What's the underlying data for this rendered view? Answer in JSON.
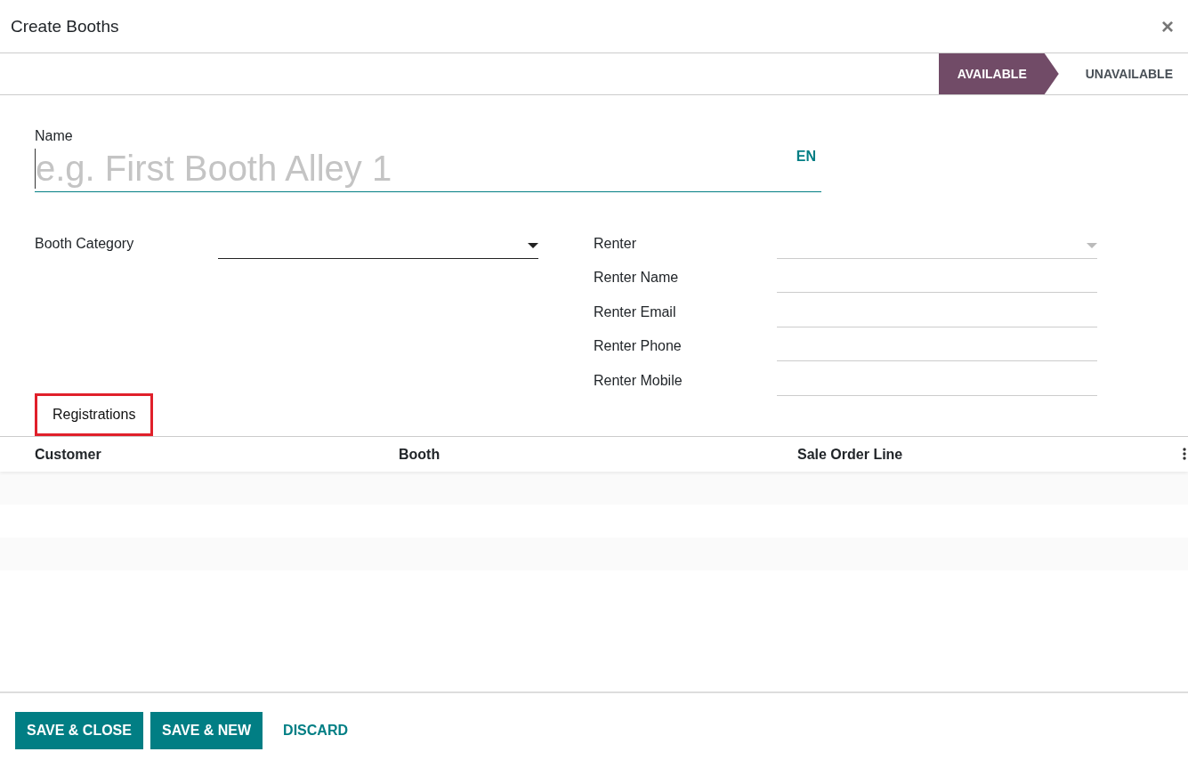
{
  "dialog": {
    "title": "Create Booths",
    "close": "×"
  },
  "status_bar": [
    {
      "label": "AVAILABLE",
      "selected": true
    },
    {
      "label": "UNAVAILABLE",
      "selected": false
    }
  ],
  "name_field": {
    "label": "Name",
    "placeholder": "e.g. First Booth Alley 1",
    "language": "EN"
  },
  "left_fields": [
    {
      "label": "Booth Category",
      "kind": "dropdown",
      "disabled": false
    }
  ],
  "renter_field": {
    "label": "Renter",
    "disabled": true
  },
  "renter_details": [
    {
      "label": "Renter Name"
    },
    {
      "label": "Renter Email"
    },
    {
      "label": "Renter Phone"
    },
    {
      "label": "Renter Mobile"
    }
  ],
  "tabs": [
    {
      "label": "Registrations",
      "selected": true,
      "highlighted": true
    }
  ],
  "table": {
    "columns": [
      "Customer",
      "Booth",
      "Sale Order Line"
    ]
  },
  "buttons": [
    {
      "label": "SAVE & CLOSE",
      "kind": "primary"
    },
    {
      "label": "SAVE & NEW",
      "kind": "primary"
    },
    {
      "label": "DISCARD",
      "kind": "link"
    }
  ]
}
